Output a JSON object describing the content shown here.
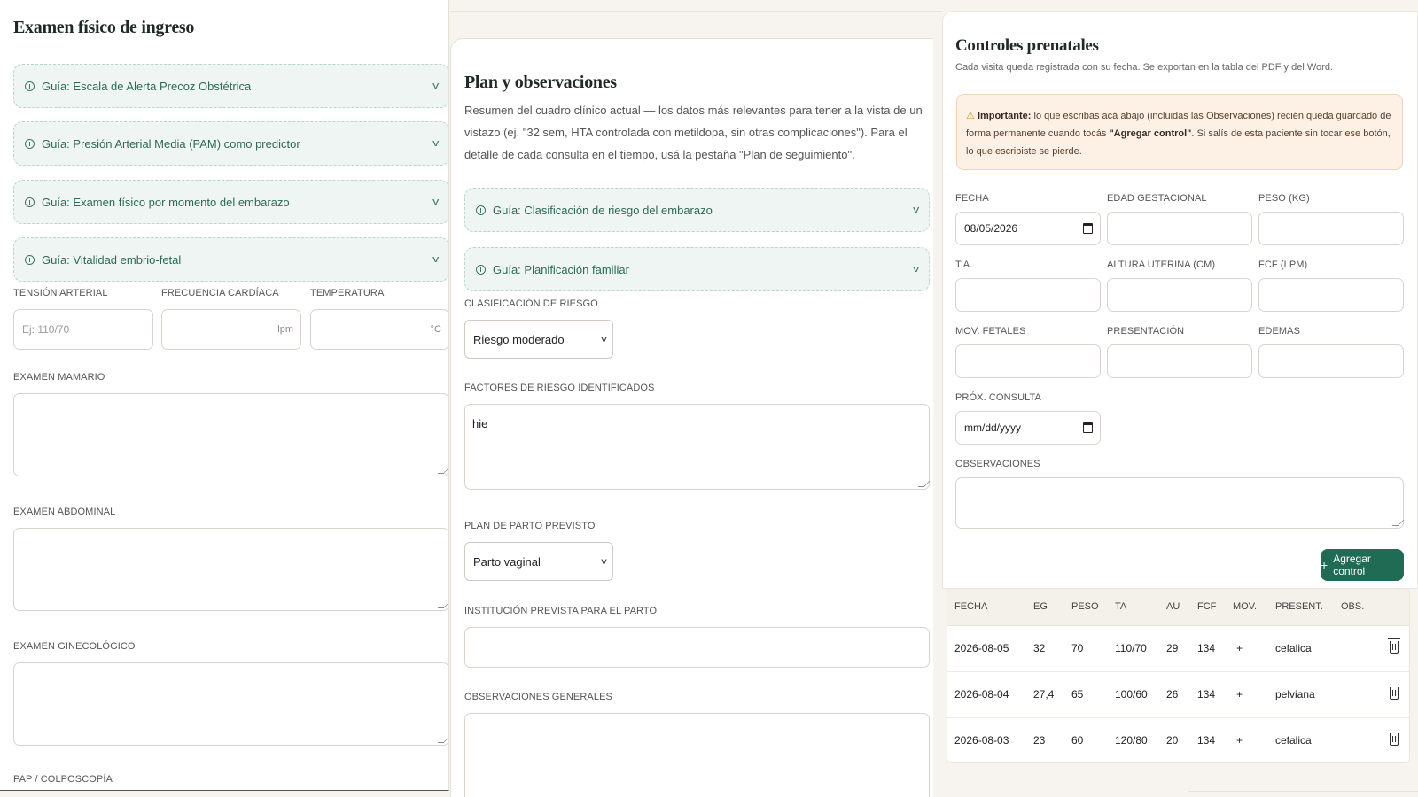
{
  "examen": {
    "title": "Examen físico de ingreso",
    "guides": [
      "Guía: Escala de Alerta Precoz Obstétrica",
      "Guía: Presión Arterial Media (PAM) como predictor",
      "Guía: Examen físico por momento del embarazo",
      "Guía: Vitalidad embrio-fetal"
    ],
    "tension_label": "TENSIÓN ARTERIAL",
    "tension_placeholder": "Ej: 110/70",
    "frecuencia_label": "FRECUENCIA CARDÍACA",
    "frecuencia_unit": "lpm",
    "temperatura_label": "TEMPERATURA",
    "temperatura_unit": "°C",
    "mamario_label": "EXAMEN MAMARIO",
    "abdominal_label": "EXAMEN ABDOMINAL",
    "ginecologico_label": "EXAMEN GINECOLÓGICO",
    "pap_label": "PAP / COLPOSCOPÍA"
  },
  "plan": {
    "title": "Plan y observaciones",
    "description": "Resumen del cuadro clínico actual — los datos más relevantes para tener a la vista de un vistazo (ej. \"32 sem, HTA controlada con metildopa, sin otras complicaciones\"). Para el detalle de cada consulta en el tiempo, usá la pestaña \"Plan de seguimiento\".",
    "guides": [
      "Guía: Clasificación de riesgo del embarazo",
      "Guía: Planificación familiar"
    ],
    "riesgo_label": "CLASIFICACIÓN DE RIESGO",
    "riesgo_value": "Riesgo moderado",
    "factores_label": "FACTORES DE RIESGO IDENTIFICADOS",
    "factores_value": "hie",
    "parto_label": "PLAN DE PARTO PREVISTO",
    "parto_value": "Parto vaginal",
    "institucion_label": "INSTITUCIÓN PREVISTA PARA EL PARTO",
    "observaciones_label": "OBSERVACIONES GENERALES"
  },
  "controles": {
    "title": "Controles prenatales",
    "subtitle": "Cada visita queda registrada con su fecha. Se exportan en la tabla del PDF y del Word.",
    "warning_icon": "⚠",
    "warning_bold1": "Importante:",
    "warning_text1": " lo que escribas acá abajo (incluidas las Observaciones) recién queda guardado de forma permanente cuando tocás ",
    "warning_bold2": "\"Agregar control\"",
    "warning_text2": ". Si salís de esta paciente sin tocar ese botón, lo que escribiste se pierde.",
    "fields": {
      "fecha_label": "FECHA",
      "fecha_value": "08/05/2026",
      "edad_label": "EDAD GESTACIONAL",
      "peso_label": "PESO (KG)",
      "ta_label": "T.A.",
      "altura_label": "ALTURA UTERINA (CM)",
      "fcf_label": "FCF (LPM)",
      "mov_label": "MOV. FETALES",
      "presentacion_label": "PRESENTACIÓN",
      "edemas_label": "EDEMAS",
      "prox_label": "PRÓX. CONSULTA",
      "prox_value": "mm/dd/yyyy",
      "obs_label": "OBSERVACIONES"
    },
    "add_button": "Agregar control",
    "table": {
      "headers": [
        "FECHA",
        "EG",
        "PESO",
        "TA",
        "AU",
        "FCF",
        "MOV.",
        "PRESENT.",
        "OBS."
      ],
      "rows": [
        [
          "2026-08-05",
          "32",
          "70",
          "110/70",
          "29",
          "134",
          "+",
          "cefalica",
          ""
        ],
        [
          "2026-08-04",
          "27,4",
          "65",
          "100/60",
          "26",
          "134",
          "+",
          "pelviana",
          ""
        ],
        [
          "2026-08-03",
          "23",
          "60",
          "120/80",
          "20",
          "134",
          "+",
          "cefalica",
          ""
        ]
      ]
    }
  }
}
